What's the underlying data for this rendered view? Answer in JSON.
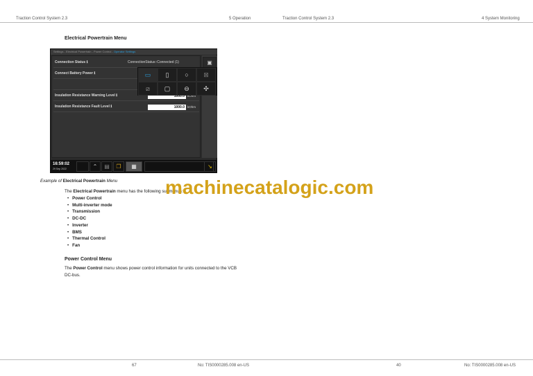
{
  "header": {
    "left_title": "Traction Control System 2.3",
    "left_section": "5 Operation",
    "right_title": "Traction Control System 2.3",
    "right_section": "4 System Monitoring"
  },
  "section_title": "Electrical Powertrain Menu",
  "screen": {
    "breadcrumb": "Settings - Electrical Powertrain - Power Control - ",
    "breadcrumb_active": "Operator Settings",
    "rows": [
      {
        "label": "Connection Status",
        "value": "ConnectionStatus::Connected (1)"
      },
      {
        "label": "Connect Battery Power"
      },
      {
        "label": "Insulation Resistance Warning Level",
        "value": "1000.0",
        "unit": "kOhm"
      },
      {
        "label": "Insulation Resistance Fault Level",
        "value": "1000.0",
        "unit": "kOhm"
      }
    ],
    "info_icon": "ℹ",
    "popup_icons": [
      "battery-icon",
      "dc-dc-icon",
      "inverter-ring-icon",
      "transmission-icon",
      "dc-converter-icon",
      "bms-icon",
      "thermal-icon",
      "fan-icon"
    ],
    "side_icons": [
      "camera-icon",
      "battery-icon",
      "thermal-icon"
    ],
    "accent": "#2aa0e0",
    "time": "16:59:02",
    "date": "29 Sep 2022"
  },
  "caption": {
    "prefix": "Example of ",
    "bold": "Electrical Powertrain",
    "suffix": " Menu"
  },
  "intro": {
    "prefix": "The ",
    "bold": "Electrical Powertrain",
    "suffix": " menu has the following submenus:"
  },
  "submenus": [
    "Power Control",
    "Multi-inverter mode",
    "Transmission",
    "DC-DC",
    "Inverter",
    "BMS",
    "Thermal Control",
    "Fan"
  ],
  "power_control": {
    "heading": "Power Control Menu",
    "prefix": "The ",
    "bold": "Power Control",
    "line1": " menu shows power control information for units connected to the VCB",
    "line2": "DC-bus."
  },
  "watermark": "machinecatalogic.com",
  "footer": {
    "left_page": "67",
    "left_doc": "No: TIS0000285.008 en-US",
    "right_page": "40",
    "right_doc": "No: TIS0000285.008 en-US"
  }
}
